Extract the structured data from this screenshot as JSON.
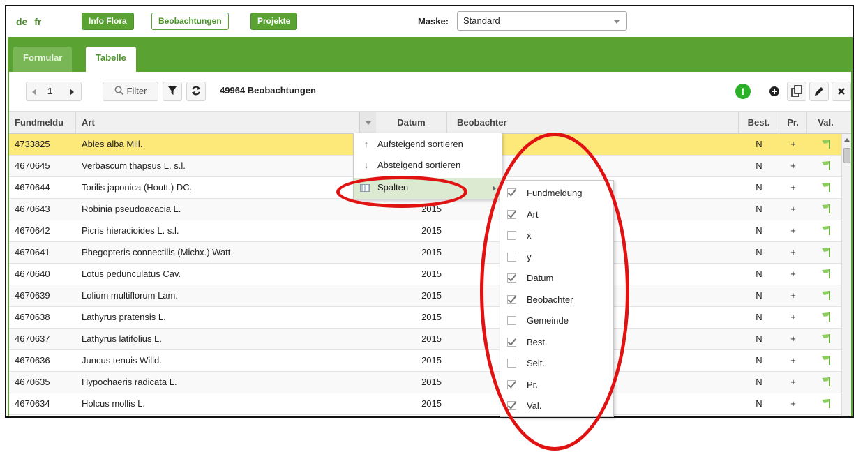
{
  "top": {
    "languages": [
      "de",
      "fr"
    ],
    "nav_buttons": [
      "Info Flora",
      "Beobachtungen",
      "Projekte"
    ],
    "maske_label": "Maske:",
    "maske_value": "Standard"
  },
  "tabs": [
    "Formular",
    "Tabelle"
  ],
  "toolbar": {
    "page": "1",
    "filter_label": "Filter",
    "count_label": "49964 Beobachtungen",
    "right_icons": [
      "exclamation-icon",
      "add-icon",
      "copy-icon",
      "edit-icon",
      "delete-icon"
    ]
  },
  "columns": [
    "Fundmeldu",
    "Art",
    "Datum",
    "Beobachter",
    "Best.",
    "Pr.",
    "Val."
  ],
  "rows": [
    {
      "id": "4733825",
      "art": "Abies alba Mill.",
      "datum": "",
      "best": "N",
      "pr": "+"
    },
    {
      "id": "4670645",
      "art": "Verbascum thapsus L. s.l.",
      "datum": "",
      "best": "N",
      "pr": "+"
    },
    {
      "id": "4670644",
      "art": "Torilis japonica (Houtt.) DC.",
      "datum": "",
      "best": "N",
      "pr": "+"
    },
    {
      "id": "4670643",
      "art": "Robinia pseudoacacia L.",
      "datum": "2015",
      "best": "N",
      "pr": "+"
    },
    {
      "id": "4670642",
      "art": "Picris hieracioides L. s.l.",
      "datum": "2015",
      "best": "N",
      "pr": "+"
    },
    {
      "id": "4670641",
      "art": "Phegopteris connectilis (Michx.) Watt",
      "datum": "2015",
      "best": "N",
      "pr": "+"
    },
    {
      "id": "4670640",
      "art": "Lotus pedunculatus Cav.",
      "datum": "2015",
      "best": "N",
      "pr": "+"
    },
    {
      "id": "4670639",
      "art": "Lolium multiflorum Lam.",
      "datum": "2015",
      "best": "N",
      "pr": "+"
    },
    {
      "id": "4670638",
      "art": "Lathyrus pratensis L.",
      "datum": "2015",
      "best": "N",
      "pr": "+"
    },
    {
      "id": "4670637",
      "art": "Lathyrus latifolius L.",
      "datum": "2015",
      "best": "N",
      "pr": "+"
    },
    {
      "id": "4670636",
      "art": "Juncus tenuis Willd.",
      "datum": "2015",
      "best": "N",
      "pr": "+"
    },
    {
      "id": "4670635",
      "art": "Hypochaeris radicata L.",
      "datum": "2015",
      "best": "N",
      "pr": "+"
    },
    {
      "id": "4670634",
      "art": "Holcus mollis L.",
      "datum": "2015",
      "best": "N",
      "pr": "+"
    }
  ],
  "context_menu": [
    "Aufsteigend sortieren",
    "Absteigend sortieren",
    "Spalten"
  ],
  "columns_menu": [
    {
      "label": "Fundmeldung",
      "checked": true
    },
    {
      "label": "Art",
      "checked": true
    },
    {
      "label": "x",
      "checked": false
    },
    {
      "label": "y",
      "checked": false
    },
    {
      "label": "Datum",
      "checked": true
    },
    {
      "label": "Beobachter",
      "checked": true
    },
    {
      "label": "Gemeinde",
      "checked": false
    },
    {
      "label": "Best.",
      "checked": true
    },
    {
      "label": "Selt.",
      "checked": false
    },
    {
      "label": "Pr.",
      "checked": true
    },
    {
      "label": "Val.",
      "checked": true
    }
  ],
  "colors": {
    "brand_green": "#5aa332",
    "selected_row": "#fde97a",
    "annotation_red": "#e01212"
  }
}
